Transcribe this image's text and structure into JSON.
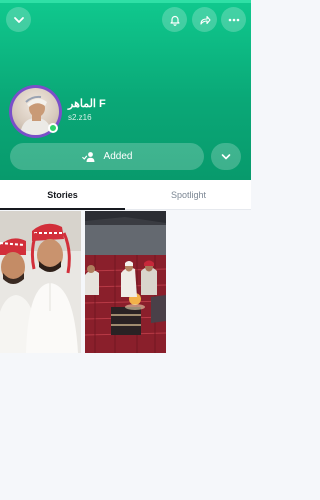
{
  "profile": {
    "display_name": "الماهر F",
    "username": "s2.z16"
  },
  "header": {
    "back_icon": "chevron-down-icon",
    "icons": [
      "notification-icon",
      "share-icon",
      "more-icon"
    ]
  },
  "actions": {
    "added_label": "Added",
    "added_icon": "user-check-icon",
    "expand_icon": "chevron-down-icon"
  },
  "tabs": [
    {
      "label": "Stories",
      "active": true
    },
    {
      "label": "Spotlight",
      "active": false
    }
  ],
  "stories": [
    {
      "name": "story-thumbnail"
    },
    {
      "name": "story-thumbnail"
    }
  ],
  "colors": {
    "header_top": "#10c98e",
    "header_bottom": "#089a6c",
    "avatar_ring": "#7a4fc9",
    "online": "#2ed46b"
  }
}
